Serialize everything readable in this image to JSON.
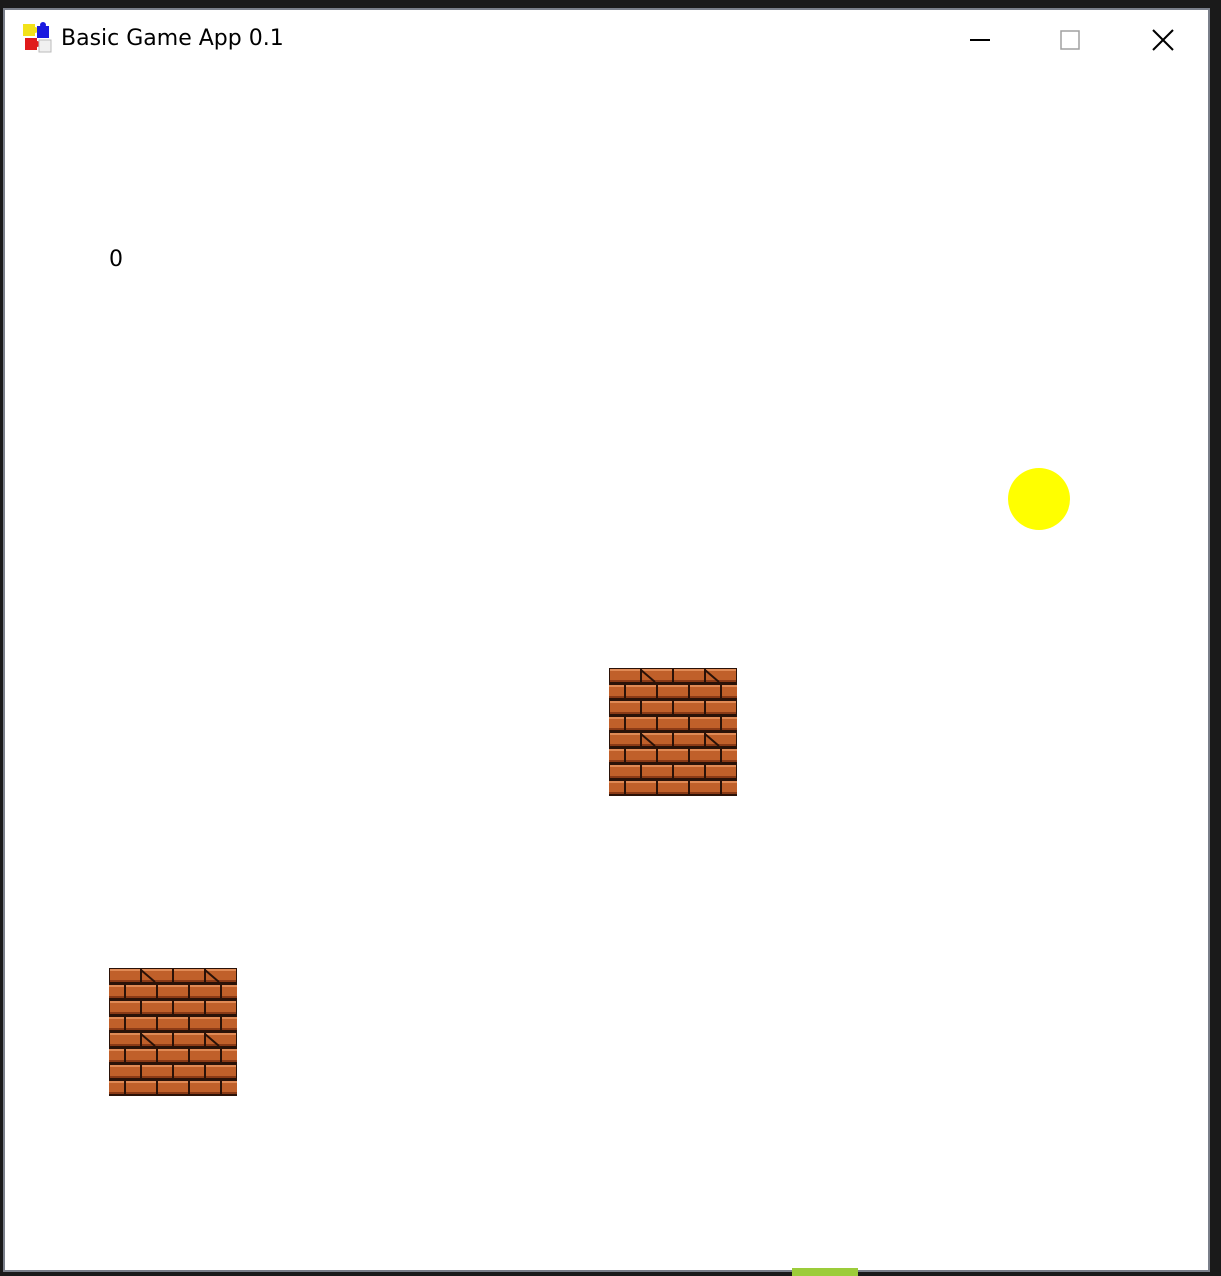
{
  "window": {
    "title": "Basic Game App 0.1",
    "app_icon": "puzzle-pieces-icon",
    "controls": {
      "minimize_icon": "minimize-icon",
      "maximize_icon": "maximize-icon",
      "close_icon": "close-icon"
    }
  },
  "game": {
    "score": "0",
    "ball": {
      "color": "#ffff00"
    },
    "bricks": [
      {
        "name": "brick-block"
      },
      {
        "name": "brick-block"
      }
    ],
    "brick_colors": {
      "mortar": "#2a1208",
      "brick": "#c0602a",
      "highlight": "#e08a55",
      "shadow": "#8a3a16"
    }
  }
}
